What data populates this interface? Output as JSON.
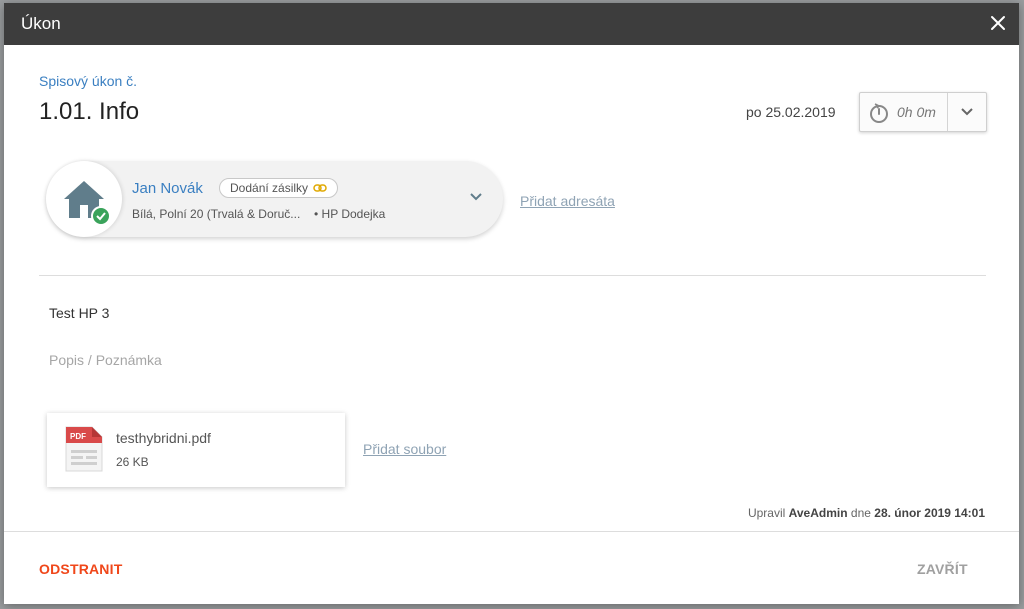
{
  "dialog": {
    "title": "Úkon",
    "close_icon": "close-icon"
  },
  "header": {
    "subtitle": "Spisový úkon č.",
    "heading": "1.01. Info",
    "date": "po 25.02.2019",
    "timer": {
      "value": "0h 0m",
      "icon": "timer-icon"
    }
  },
  "recipient": {
    "name": "Jan Novák",
    "badge_label": "Dodání zásilky",
    "address": "Bílá, Polní 20  (Trvalá & Doruč...",
    "delivery": "•  HP Dodejka",
    "avatar_icon": "house-check-icon",
    "add_label": "Přidat adresáta"
  },
  "content": {
    "item_title": "Test HP 3",
    "note_placeholder": "Popis / Poznámka"
  },
  "attachment": {
    "filename": "testhybridni.pdf",
    "size": "26 KB",
    "type_label": "PDF",
    "add_label": "Přidat soubor"
  },
  "modified": {
    "prefix": "Upravil",
    "user": "AveAdmin",
    "middle": "dne",
    "datetime": "28. únor 2019 14:01"
  },
  "footer": {
    "delete_label": "ODSTRANIT",
    "close_label": "ZAVŘÍT"
  },
  "colors": {
    "titlebar": "#3d3d3d",
    "link_blue": "#3a7fc1",
    "danger": "#f0471a",
    "success": "#3aa35b",
    "pdf_red": "#d94a4a"
  }
}
